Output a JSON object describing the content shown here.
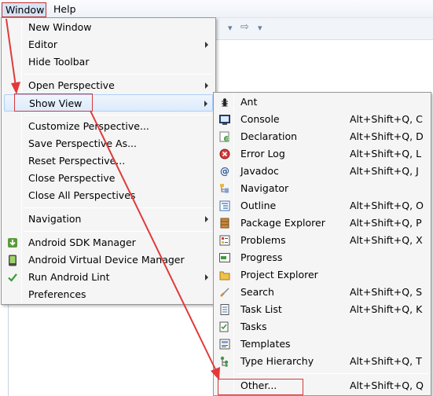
{
  "menubar": {
    "window": "Window",
    "help": "Help"
  },
  "toolbar": {
    "icons": [
      "dropdown-arrow-icon",
      "forward-arrow-icon",
      "dropdown-arrow-icon"
    ]
  },
  "window_menu": {
    "items": [
      {
        "label": "New Window"
      },
      {
        "label": "Editor",
        "submenu": true
      },
      {
        "label": "Hide Toolbar"
      },
      {
        "label": "Open Perspective",
        "submenu": true
      },
      {
        "label": "Show View",
        "submenu": true,
        "highlighted": true
      },
      {
        "label": "Customize Perspective..."
      },
      {
        "label": "Save Perspective As..."
      },
      {
        "label": "Reset Perspective..."
      },
      {
        "label": "Close Perspective"
      },
      {
        "label": "Close All Perspectives"
      },
      {
        "label": "Navigation",
        "submenu": true
      },
      {
        "label": "Android SDK Manager",
        "icon": "android-sdk-manager-icon"
      },
      {
        "label": "Android Virtual Device Manager",
        "icon": "android-avd-manager-icon"
      },
      {
        "label": "Run Android Lint",
        "icon": "lint-check-icon",
        "submenu": true
      },
      {
        "label": "Preferences"
      }
    ]
  },
  "show_view_menu": {
    "items": [
      {
        "label": "Ant",
        "shortcut": "",
        "icon": "ant-icon"
      },
      {
        "label": "Console",
        "shortcut": "Alt+Shift+Q, C",
        "icon": "console-icon"
      },
      {
        "label": "Declaration",
        "shortcut": "Alt+Shift+Q, D",
        "icon": "declaration-icon"
      },
      {
        "label": "Error Log",
        "shortcut": "Alt+Shift+Q, L",
        "icon": "error-log-icon"
      },
      {
        "label": "Javadoc",
        "shortcut": "Alt+Shift+Q, J",
        "icon": "javadoc-icon"
      },
      {
        "label": "Navigator",
        "shortcut": "",
        "icon": "navigator-icon"
      },
      {
        "label": "Outline",
        "shortcut": "Alt+Shift+Q, O",
        "icon": "outline-icon"
      },
      {
        "label": "Package Explorer",
        "shortcut": "Alt+Shift+Q, P",
        "icon": "package-explorer-icon"
      },
      {
        "label": "Problems",
        "shortcut": "Alt+Shift+Q, X",
        "icon": "problems-icon"
      },
      {
        "label": "Progress",
        "shortcut": "",
        "icon": "progress-icon"
      },
      {
        "label": "Project Explorer",
        "shortcut": "",
        "icon": "project-explorer-icon"
      },
      {
        "label": "Search",
        "shortcut": "Alt+Shift+Q, S",
        "icon": "search-icon"
      },
      {
        "label": "Task List",
        "shortcut": "Alt+Shift+Q, K",
        "icon": "task-list-icon"
      },
      {
        "label": "Tasks",
        "shortcut": "",
        "icon": "tasks-icon"
      },
      {
        "label": "Templates",
        "shortcut": "",
        "icon": "templates-icon"
      },
      {
        "label": "Type Hierarchy",
        "shortcut": "Alt+Shift+Q, T",
        "icon": "type-hierarchy-icon"
      },
      {
        "label": "Other...",
        "shortcut": "Alt+Shift+Q, Q",
        "icon": ""
      }
    ]
  },
  "annotations": {
    "color": "#d23a3a"
  }
}
